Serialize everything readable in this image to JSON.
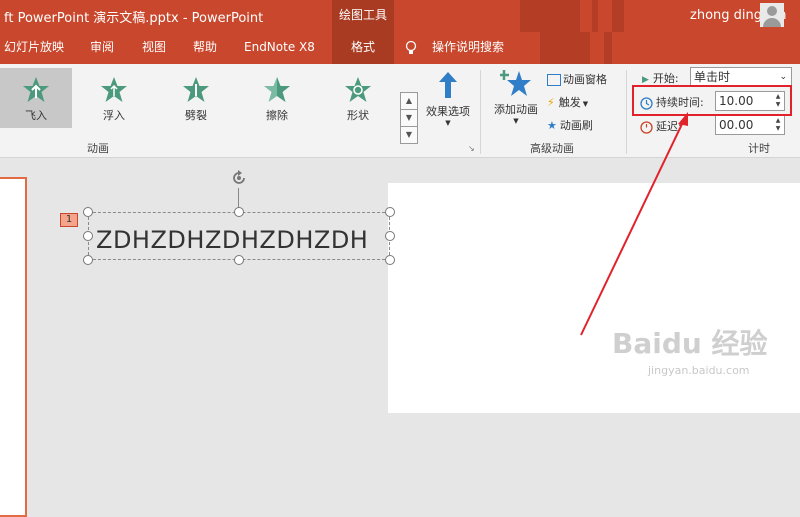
{
  "titlebar": {
    "title": "ft PowerPoint 演示文稿.pptx  -  PowerPoint",
    "tools_tab": "绘图工具",
    "user": "zhong dinghan"
  },
  "menu": {
    "items": [
      "幻灯片放映",
      "审阅",
      "视图",
      "帮助",
      "EndNote X8",
      "格式"
    ],
    "active": "格式",
    "tell_me": "操作说明搜索"
  },
  "ribbon": {
    "animations": [
      {
        "label": "飞入",
        "selected": true
      },
      {
        "label": "浮入",
        "selected": false
      },
      {
        "label": "劈裂",
        "selected": false
      },
      {
        "label": "擦除",
        "selected": false
      },
      {
        "label": "形状",
        "selected": false
      }
    ],
    "effect_options": "效果选项",
    "group_animation": "动画",
    "add_animation": "添加动画",
    "animation_pane": "动画窗格",
    "trigger": "触发",
    "animation_painter": "动画刷",
    "group_advanced": "高级动画",
    "start_label": "开始:",
    "start_value": "单击时",
    "duration_label": "持续时间:",
    "duration_value": "10.00",
    "delay_label": "延迟:",
    "delay_value": "00.00",
    "group_timing": "计时"
  },
  "slide": {
    "anim_order": "1",
    "text": "ZDHZDHZDHZDHZDH"
  },
  "watermark": {
    "brand": "Baidu 经验",
    "url": "jingyan.baidu.com"
  },
  "colors": {
    "accent": "#c9472c",
    "accent_dark": "#a83b22",
    "highlight": "#e2222a",
    "star": "#4c9a7e"
  }
}
